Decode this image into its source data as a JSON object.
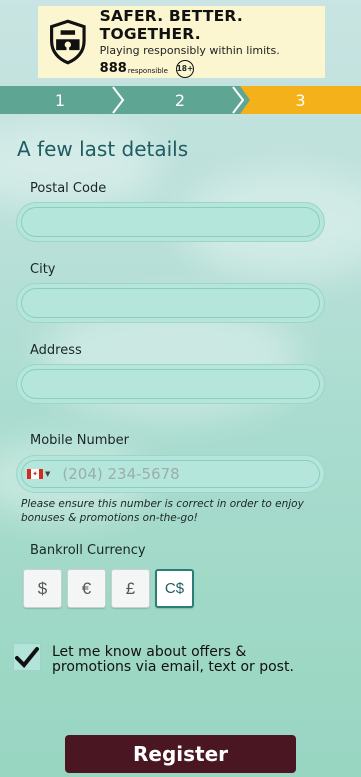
{
  "banner": {
    "title": "SAFER. BETTER. TOGETHER.",
    "subtitle": "Playing responsibly within limits.",
    "brand": "888",
    "brand_suffix": "responsible",
    "age": "18+"
  },
  "steps": [
    {
      "label": "1",
      "state": "done"
    },
    {
      "label": "2",
      "state": "done"
    },
    {
      "label": "3",
      "state": "current"
    }
  ],
  "heading": "A few last details",
  "fields": {
    "postal_code": {
      "label": "Postal Code",
      "value": ""
    },
    "city": {
      "label": "City",
      "value": ""
    },
    "address": {
      "label": "Address",
      "value": ""
    },
    "mobile": {
      "label": "Mobile Number",
      "placeholder": "(204) 234-5678",
      "country": "CA"
    }
  },
  "mobile_hint": "Please ensure this number is correct in order to enjoy bonuses & promotions on-the-go!",
  "currency": {
    "label": "Bankroll Currency",
    "options": [
      "$",
      "€",
      "£",
      "C$"
    ],
    "selected": "C$"
  },
  "consent": {
    "text": "Let me know about offers & promotions via email, text or post.",
    "checked": true
  },
  "register_label": "Register",
  "colors": {
    "step_done": "#5fa593",
    "step_current": "#f4b11a",
    "register_bg": "#4a1621",
    "heading": "#1f5d63"
  }
}
